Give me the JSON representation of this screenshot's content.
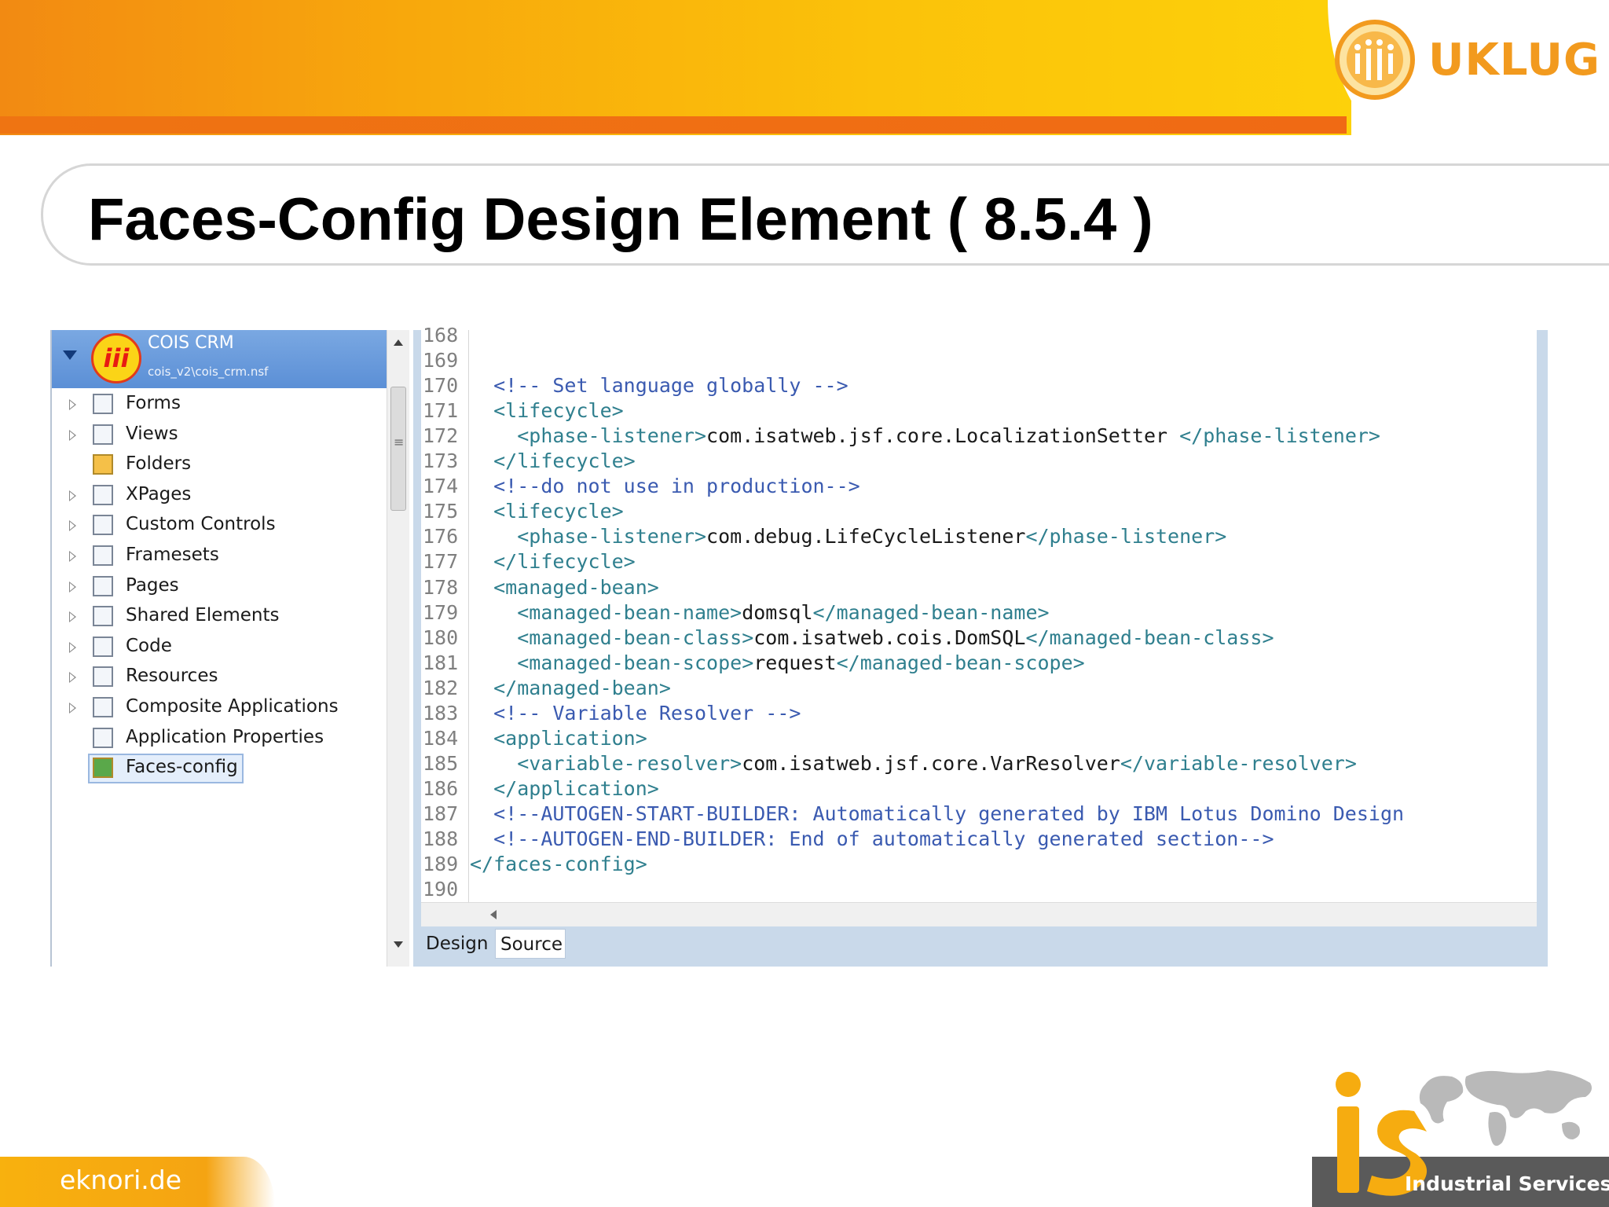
{
  "brand": {
    "logo_text": "UKLUG",
    "footer_left": "eknori.de",
    "footer_right": "Industrial Services",
    "colors": {
      "orange": "#f28a12",
      "yellow": "#fbc20a",
      "blue_header": "#5b8fd6"
    }
  },
  "slide": {
    "title": "Faces-Config Design Element ( 8.5.4 )"
  },
  "navigator": {
    "app_title": "COIS CRM",
    "app_path": "cois_v2\\cois_crm.nsf",
    "app_icon_text": "iii",
    "items": [
      {
        "label": "Forms",
        "icon": "form-icon",
        "expandable": true
      },
      {
        "label": "Views",
        "icon": "view-icon",
        "expandable": true
      },
      {
        "label": "Folders",
        "icon": "folder-icon",
        "expandable": false
      },
      {
        "label": "XPages",
        "icon": "xpage-icon",
        "expandable": true
      },
      {
        "label": "Custom Controls",
        "icon": "custom-control-icon",
        "expandable": true
      },
      {
        "label": "Framesets",
        "icon": "frameset-icon",
        "expandable": true
      },
      {
        "label": "Pages",
        "icon": "page-icon",
        "expandable": true
      },
      {
        "label": "Shared Elements",
        "icon": "shared-elements-icon",
        "expandable": true
      },
      {
        "label": "Code",
        "icon": "code-icon",
        "expandable": true
      },
      {
        "label": "Resources",
        "icon": "resources-icon",
        "expandable": true
      },
      {
        "label": "Composite Applications",
        "icon": "composite-app-icon",
        "expandable": true
      },
      {
        "label": "Application Properties",
        "icon": "app-properties-icon",
        "expandable": false
      },
      {
        "label": "Faces-config",
        "icon": "faces-config-icon",
        "expandable": false,
        "selected": true
      }
    ]
  },
  "editor": {
    "lines": [
      {
        "n": "168",
        "parts": []
      },
      {
        "n": "169",
        "parts": []
      },
      {
        "n": "170",
        "parts": [
          [
            "",
            "  "
          ],
          [
            "cmt",
            "<!-- Set language globally -->"
          ]
        ]
      },
      {
        "n": "171",
        "parts": [
          [
            "",
            "  "
          ],
          [
            "tag",
            "<lifecycle>"
          ]
        ]
      },
      {
        "n": "172",
        "parts": [
          [
            "",
            "    "
          ],
          [
            "tag",
            "<phase-listener>"
          ],
          [
            "txt",
            "com.isatweb.jsf.core.LocalizationSetter "
          ],
          [
            "tag",
            "</phase-listener>"
          ]
        ]
      },
      {
        "n": "173",
        "parts": [
          [
            "",
            "  "
          ],
          [
            "tag",
            "</lifecycle>"
          ]
        ]
      },
      {
        "n": "174",
        "parts": [
          [
            "",
            "  "
          ],
          [
            "cmt",
            "<!--do not use in production-->"
          ]
        ]
      },
      {
        "n": "175",
        "parts": [
          [
            "",
            "  "
          ],
          [
            "tag",
            "<lifecycle>"
          ]
        ]
      },
      {
        "n": "176",
        "parts": [
          [
            "",
            "    "
          ],
          [
            "tag",
            "<phase-listener>"
          ],
          [
            "txt",
            "com.debug.LifeCycleListener"
          ],
          [
            "tag",
            "</phase-listener>"
          ]
        ]
      },
      {
        "n": "177",
        "parts": [
          [
            "",
            "  "
          ],
          [
            "tag",
            "</lifecycle>"
          ]
        ]
      },
      {
        "n": "178",
        "parts": [
          [
            "",
            "  "
          ],
          [
            "tag",
            "<managed-bean>"
          ]
        ]
      },
      {
        "n": "179",
        "parts": [
          [
            "",
            "    "
          ],
          [
            "tag",
            "<managed-bean-name>"
          ],
          [
            "txt",
            "domsql"
          ],
          [
            "tag",
            "</managed-bean-name>"
          ]
        ]
      },
      {
        "n": "180",
        "parts": [
          [
            "",
            "    "
          ],
          [
            "tag",
            "<managed-bean-class>"
          ],
          [
            "txt",
            "com.isatweb.cois.DomSQL"
          ],
          [
            "tag",
            "</managed-bean-class>"
          ]
        ]
      },
      {
        "n": "181",
        "parts": [
          [
            "",
            "    "
          ],
          [
            "tag",
            "<managed-bean-scope>"
          ],
          [
            "txt",
            "request"
          ],
          [
            "tag",
            "</managed-bean-scope>"
          ]
        ]
      },
      {
        "n": "182",
        "parts": [
          [
            "",
            "  "
          ],
          [
            "tag",
            "</managed-bean>"
          ]
        ]
      },
      {
        "n": "183",
        "parts": [
          [
            "",
            "  "
          ],
          [
            "cmt",
            "<!-- Variable Resolver -->"
          ]
        ]
      },
      {
        "n": "184",
        "parts": [
          [
            "",
            "  "
          ],
          [
            "tag",
            "<application>"
          ]
        ]
      },
      {
        "n": "185",
        "parts": [
          [
            "",
            "    "
          ],
          [
            "tag",
            "<variable-resolver>"
          ],
          [
            "txt",
            "com.isatweb.jsf.core.VarResolver"
          ],
          [
            "tag",
            "</variable-resolver>"
          ]
        ]
      },
      {
        "n": "186",
        "parts": [
          [
            "",
            "  "
          ],
          [
            "tag",
            "</application>"
          ]
        ]
      },
      {
        "n": "187",
        "parts": [
          [
            "",
            "  "
          ],
          [
            "cmt",
            "<!--AUTOGEN-START-BUILDER: Automatically generated by IBM Lotus Domino Design"
          ]
        ]
      },
      {
        "n": "188",
        "parts": [
          [
            "",
            "  "
          ],
          [
            "cmt",
            "<!--AUTOGEN-END-BUILDER: End of automatically generated section-->"
          ]
        ]
      },
      {
        "n": "189",
        "parts": [
          [
            "tag",
            "</faces-config>"
          ]
        ]
      },
      {
        "n": "190",
        "parts": []
      }
    ],
    "tabs": [
      {
        "label": "Design",
        "active": false
      },
      {
        "label": "Source",
        "active": true
      }
    ]
  }
}
